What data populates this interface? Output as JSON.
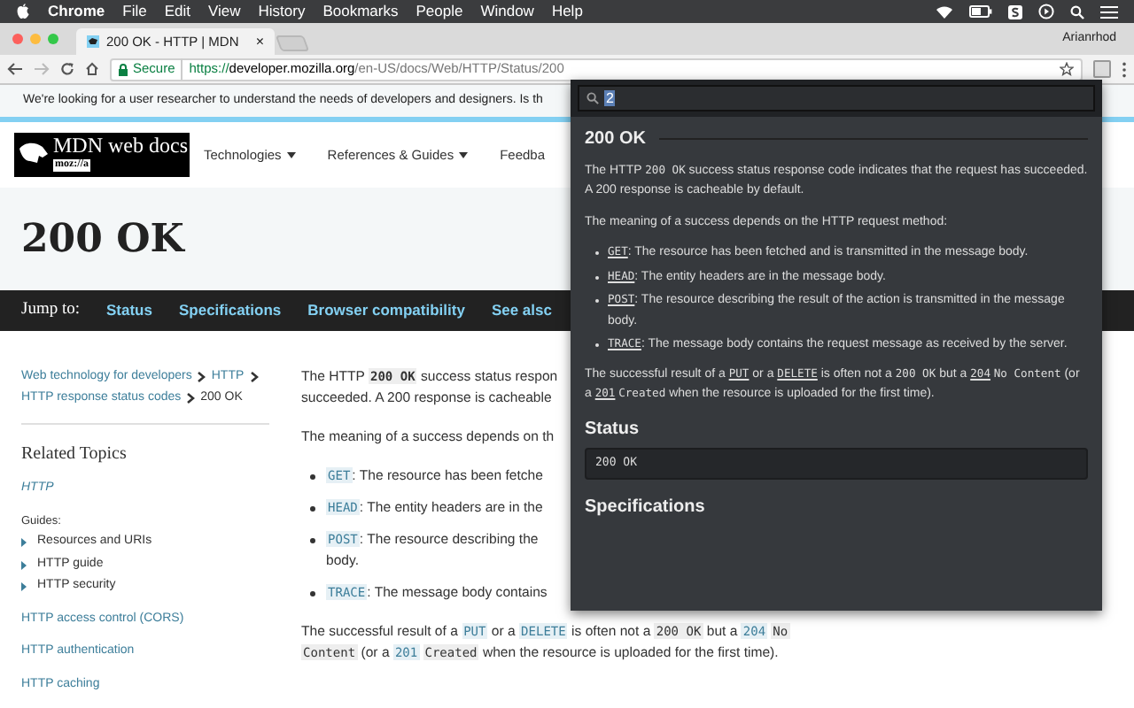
{
  "menubar": {
    "app": "Chrome",
    "items": [
      "File",
      "Edit",
      "View",
      "History",
      "Bookmarks",
      "People",
      "Window",
      "Help"
    ]
  },
  "browser": {
    "tab": {
      "title": "200 OK - HTTP | MDN",
      "close": "×"
    },
    "user": "Arianrhod",
    "secure": "Secure",
    "url_scheme": "https://",
    "url_host": "developer.mozilla.org",
    "url_path": "/en-US/docs/Web/HTTP/Status/200"
  },
  "banner": "We're looking for a user researcher to understand the needs of developers and designers. Is th",
  "header": {
    "logo_title": "MDN web docs",
    "logo_sub": "moz://a",
    "nav": [
      {
        "label": "Technologies",
        "dropdown": true
      },
      {
        "label": "References & Guides",
        "dropdown": true
      },
      {
        "label": "Feedba",
        "dropdown": false
      }
    ]
  },
  "page_title": "200 OK",
  "jump": {
    "label": "Jump to:",
    "links": [
      "Status",
      "Specifications",
      "Browser compatibility",
      "See alsc"
    ]
  },
  "breadcrumbs": [
    {
      "label": "Web technology for developers",
      "link": true
    },
    {
      "label": "HTTP",
      "link": true
    },
    {
      "label": "HTTP response status codes",
      "link": true
    },
    {
      "label": "200 OK",
      "link": false
    }
  ],
  "sidebar": {
    "heading": "Related Topics",
    "section": "HTTP",
    "guides_label": "Guides:",
    "guides": [
      "Resources and URIs",
      "HTTP guide",
      "HTTP security"
    ],
    "links": [
      "HTTP access control (CORS)",
      "HTTP authentication",
      "HTTP caching"
    ]
  },
  "article": {
    "paragraphs": [
      [
        [
          {
            "kind": "text",
            "text": "The HTTP "
          },
          {
            "kind": "strong_code",
            "text": "200 OK"
          },
          {
            "kind": "text",
            "text": " success status respon"
          }
        ],
        [
          {
            "kind": "text",
            "text": "succeeded. A 200 response is cacheable"
          }
        ]
      ],
      [
        [
          {
            "kind": "text",
            "text": "The meaning of a success depends on th"
          }
        ]
      ]
    ],
    "list": [
      [
        [
          {
            "kind": "link_code",
            "text": "GET"
          },
          {
            "kind": "text",
            "text": ": The resource has been fetche"
          }
        ]
      ],
      [
        [
          {
            "kind": "link_code",
            "text": "HEAD"
          },
          {
            "kind": "text",
            "text": ": The entity headers are in the"
          }
        ]
      ],
      [
        [
          {
            "kind": "link_code",
            "text": "POST"
          },
          {
            "kind": "text",
            "text": ": The resource describing the"
          }
        ],
        [
          {
            "kind": "text",
            "text": "body."
          }
        ]
      ],
      [
        [
          {
            "kind": "link_code",
            "text": "TRACE"
          },
          {
            "kind": "text",
            "text": ": The message body contains"
          }
        ]
      ]
    ],
    "closing": [
      [
        {
          "kind": "text",
          "text": "The successful result of a "
        },
        {
          "kind": "link_code",
          "text": "PUT"
        },
        {
          "kind": "text",
          "text": " or a "
        },
        {
          "kind": "link_code",
          "text": "DELETE"
        },
        {
          "kind": "text",
          "text": " is often not a "
        },
        {
          "kind": "code",
          "text": "200 OK"
        },
        {
          "kind": "text",
          "text": " but a "
        },
        {
          "kind": "link_code",
          "text": "204"
        },
        {
          "kind": "code_spaced",
          "text": "No"
        }
      ],
      [
        {
          "kind": "code",
          "text": "Content"
        },
        {
          "kind": "text",
          "text": " (or a "
        },
        {
          "kind": "link_code",
          "text": "201"
        },
        {
          "kind": "code_spaced",
          "text": "Created"
        },
        {
          "kind": "text",
          "text": " when the resource is uploaded for the first time)."
        }
      ]
    ]
  },
  "popup": {
    "search_value": "2",
    "title": "200 OK",
    "paragraphs": [
      [
        {
          "kind": "text",
          "text": "The HTTP "
        },
        {
          "kind": "code",
          "text": "200 OK"
        },
        {
          "kind": "text",
          "text": " success status response code indicates that the request has succeeded. A 200 response is cacheable by default."
        }
      ],
      [
        {
          "kind": "text",
          "text": "The meaning of a success depends on the HTTP request method:"
        }
      ]
    ],
    "list": [
      [
        {
          "kind": "link_code",
          "text": "GET"
        },
        {
          "kind": "text",
          "text": ": The resource has been fetched and is transmitted in the message body."
        }
      ],
      [
        {
          "kind": "link_code",
          "text": "HEAD"
        },
        {
          "kind": "text",
          "text": ": The entity headers are in the message body."
        }
      ],
      [
        {
          "kind": "link_code",
          "text": "POST"
        },
        {
          "kind": "text",
          "text": ": The resource describing the result of the action is transmitted in the message body."
        }
      ],
      [
        {
          "kind": "link_code",
          "text": "TRACE"
        },
        {
          "kind": "text",
          "text": ": The message body contains the request message as received by the server."
        }
      ]
    ],
    "closing": [
      {
        "kind": "text",
        "text": "The successful result of a "
      },
      {
        "kind": "link_code",
        "text": "PUT"
      },
      {
        "kind": "text",
        "text": " or a "
      },
      {
        "kind": "link_code",
        "text": "DELETE"
      },
      {
        "kind": "text",
        "text": " is often not a "
      },
      {
        "kind": "code",
        "text": "200 OK"
      },
      {
        "kind": "text",
        "text": " but a "
      },
      {
        "kind": "link_code",
        "text": "204"
      },
      {
        "kind": "code_spaced",
        "text": "No Content"
      },
      {
        "kind": "text",
        "text": " (or a "
      },
      {
        "kind": "link_code",
        "text": "201"
      },
      {
        "kind": "code_spaced",
        "text": "Created"
      },
      {
        "kind": "text",
        "text": " when the resource is uploaded for the first time)."
      }
    ],
    "status_heading": "Status",
    "status_code": "200 OK",
    "spec_heading": "Specifications"
  }
}
